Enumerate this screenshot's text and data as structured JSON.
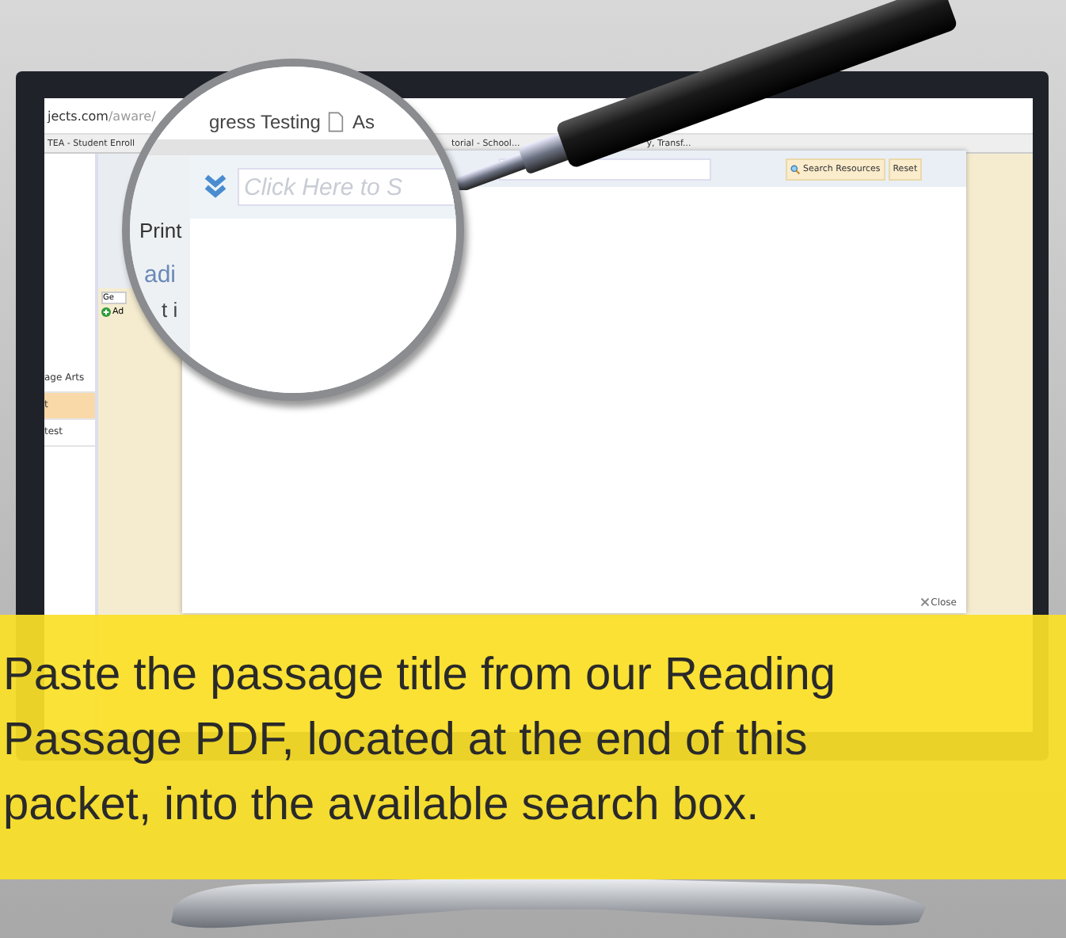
{
  "browser": {
    "address_host": "jects.com",
    "address_path": "/aware/",
    "bookmarks": [
      "TEA - Student Enroll",
      "torial - School...",
      "y, Transf..."
    ]
  },
  "sidebar": {
    "items": [
      {
        "label": "age Arts",
        "selected": false
      },
      {
        "label": "t",
        "selected": true
      },
      {
        "label": "test",
        "selected": false
      }
    ]
  },
  "main_page": {
    "tab": "Ge",
    "add_button": "Ad"
  },
  "dialog": {
    "buttons": [
      "Search Resources",
      "Reset"
    ],
    "close": "Close"
  },
  "magnifier": {
    "tabs": [
      "gress Testing",
      "As"
    ],
    "search": {
      "placeholder": "Click Here to S"
    },
    "labels": [
      "Print",
      "adi",
      "t i"
    ]
  },
  "caption": {
    "lines": [
      "Paste the passage title from our Reading",
      "Passage PDF, located at the end of this",
      "packet, into the available search box."
    ]
  }
}
